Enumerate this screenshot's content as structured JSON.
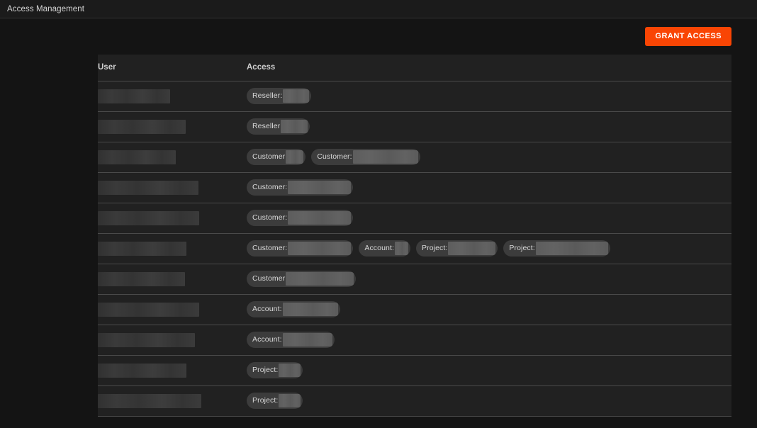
{
  "topbar": {
    "title": "Access Management"
  },
  "actions": {
    "grant_access_label": "GRANT ACCESS"
  },
  "table": {
    "columns": {
      "user": "User",
      "access": "Access"
    },
    "rows": [
      {
        "user_redacted_width": 102,
        "badges": [
          {
            "label": "Reseller:",
            "redacted_width": 37
          }
        ]
      },
      {
        "user_redacted_width": 124,
        "badges": [
          {
            "label": "Reseller",
            "redacted_width": 38
          }
        ]
      },
      {
        "user_redacted_width": 110,
        "badges": [
          {
            "label": "Customer",
            "redacted_width": 25
          },
          {
            "label": "Customer:",
            "redacted_width": 92
          }
        ]
      },
      {
        "user_redacted_width": 142,
        "badges": [
          {
            "label": "Customer:",
            "redacted_width": 89
          }
        ]
      },
      {
        "user_redacted_width": 143,
        "badges": [
          {
            "label": "Customer:",
            "redacted_width": 89
          }
        ]
      },
      {
        "user_redacted_width": 125,
        "badges": [
          {
            "label": "Customer:",
            "redacted_width": 89
          },
          {
            "label": "Account:",
            "redacted_width": 19
          },
          {
            "label": "Project:",
            "redacted_width": 67
          },
          {
            "label": "Project:",
            "redacted_width": 102
          }
        ]
      },
      {
        "user_redacted_width": 123,
        "badges": [
          {
            "label": "Customer",
            "redacted_width": 96
          }
        ]
      },
      {
        "user_redacted_width": 143,
        "badges": [
          {
            "label": "Account:",
            "redacted_width": 78
          }
        ]
      },
      {
        "user_redacted_width": 137,
        "badges": [
          {
            "label": "Account:",
            "redacted_width": 70
          }
        ]
      },
      {
        "user_redacted_width": 125,
        "badges": [
          {
            "label": "Project:",
            "redacted_width": 31
          }
        ]
      },
      {
        "user_redacted_width": 146,
        "badges": [
          {
            "label": "Project:",
            "redacted_width": 31
          }
        ]
      }
    ]
  },
  "colors": {
    "page_background": "#141414",
    "topbar_background": "#1b1b1b",
    "table_background": "#212121",
    "row_divider": "#4a4a4a",
    "accent_button": "#f94504",
    "badge_background": "#3c3c3c",
    "redaction_block": "#5f5f5f",
    "text_primary": "#e8e8e8"
  }
}
